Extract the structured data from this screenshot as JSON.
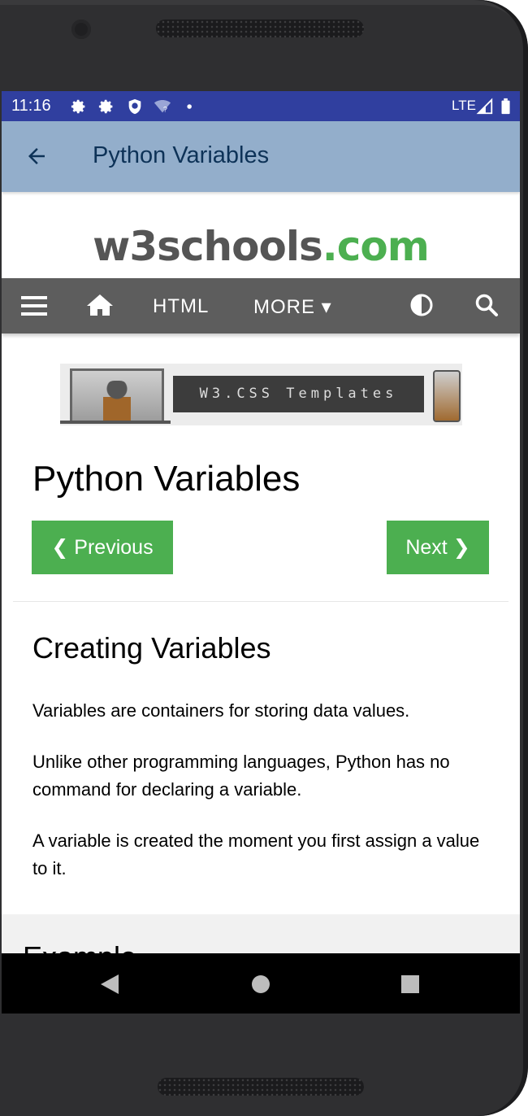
{
  "status_bar": {
    "time": "11:16",
    "network": "LTE",
    "icons": [
      "settings-icon",
      "settings-icon",
      "shield-icon",
      "wifi-question-icon",
      "dot-icon",
      "signal-icon",
      "battery-icon"
    ]
  },
  "app_bar": {
    "title": "Python Variables",
    "back_icon": "arrow-back-icon"
  },
  "site": {
    "logo_main": "w3schools",
    "logo_tld": ".com",
    "nav": {
      "html_label": "HTML",
      "more_label": "MORE ▾"
    },
    "banner_text": "W3.CSS Templates"
  },
  "page": {
    "title": "Python Variables",
    "previous_label": "❮ Previous",
    "next_label": "Next ❯",
    "section_title": "Creating Variables",
    "paragraphs": [
      "Variables are containers for storing data values.",
      "Unlike other programming languages, Python has no command for declaring a variable.",
      "A variable is created the moment you first assign a value to it."
    ],
    "example_heading": "Example"
  },
  "colors": {
    "status_bar": "#303f9f",
    "app_bar": "#93aecb",
    "app_title": "#0d3257",
    "nav_bg": "#5d5d5d",
    "accent_green": "#4caf50"
  }
}
